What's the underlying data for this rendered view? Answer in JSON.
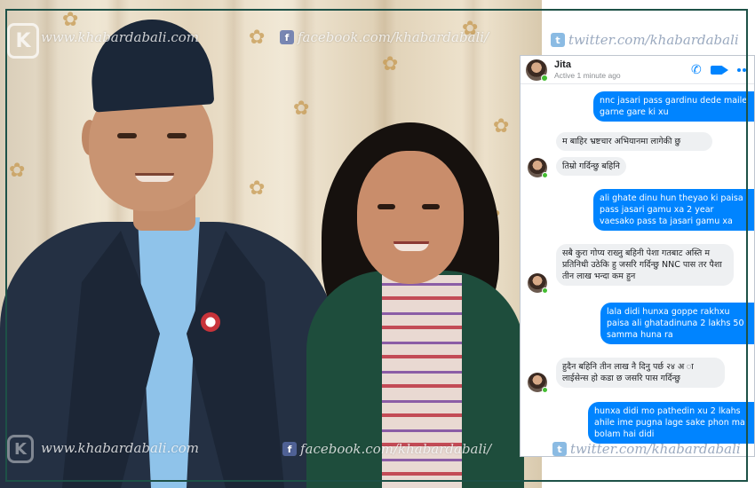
{
  "watermarks": {
    "site": "www.khabardabali.com",
    "facebook": "facebook.com/khabardabali/",
    "twitter": "twitter.com/khabardabali",
    "logo_letter": "K"
  },
  "chat": {
    "contact_name": "Jita",
    "status": "Active 1 minute ago",
    "icons": [
      "phone-icon",
      "video-camera-icon",
      "more-dots-icon"
    ],
    "messages": [
      {
        "from": "me",
        "text": "nnc jasari pass gardinu dede maile garne gare ki xu"
      },
      {
        "from": "them",
        "text": "म बाहिर भ्रष्टचार अभियानमा लागेकी छु"
      },
      {
        "from": "them",
        "text": "तिम्रो गर्दिन्छु बहिनि"
      },
      {
        "from": "me",
        "text": "ali ghate dinu hun theyao ki paisa pass jasari gamu xa 2 year vaesako pass ta jasari gamu xa"
      },
      {
        "from": "them",
        "text": "सबै कुरा गोप्य राख्नु बहिनी पेशा गतबाट अस्ति म प्रतिनिधी उठेकि हु जसरि गर्दिन्छु NNC पास तर पैशा तीन लाख भन्दा कम हुन"
      },
      {
        "from": "me",
        "text": "lala didi hunxa goppe rakhxu paisa ali ghatadinuna 2 lakhs 50 samma huna ra"
      },
      {
        "from": "them",
        "text": "हुदैन बहिनि तीन लाख नै दिनु पर्छ २४ अ ा लाईसेन्स हो कडा छ जसरि पास गर्दिन्छु"
      },
      {
        "from": "me",
        "text": "hunxa didi mo pathedin xu 2 lkahs ahile ime pugna lage sake phon ma bolam hai didi"
      }
    ]
  },
  "colors": {
    "frame": "#1d5147",
    "outgoing_bubble": "#0084ff",
    "incoming_bubble": "#eef0f2",
    "online_dot": "#44bd32"
  }
}
